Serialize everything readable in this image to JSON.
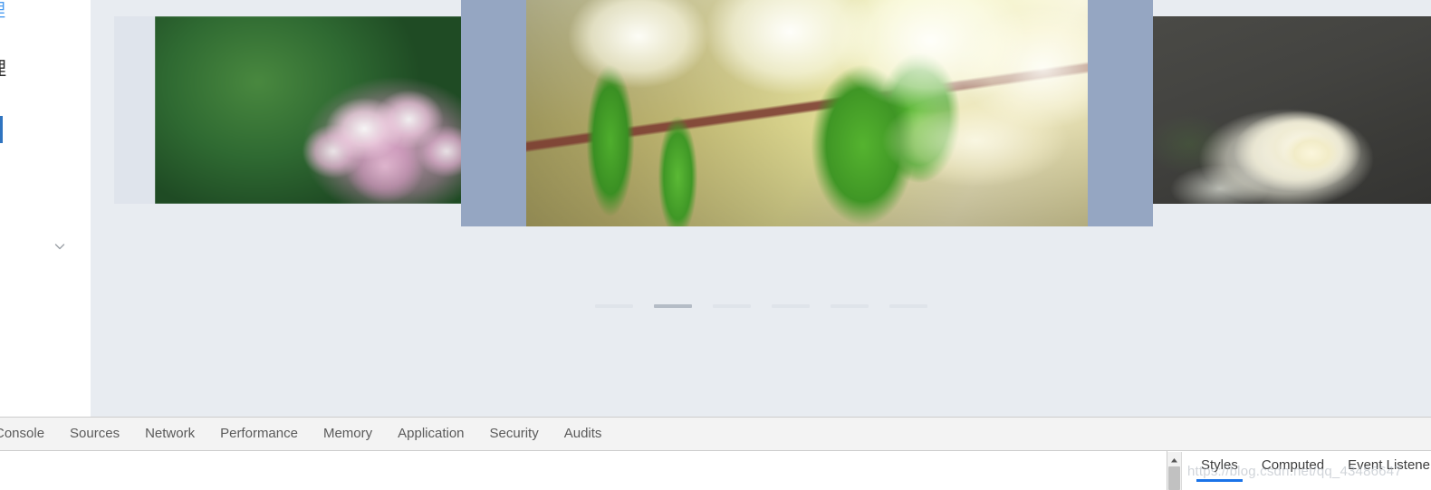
{
  "sidebar": {
    "top_link_label": "理",
    "section_label": "理",
    "active_item_label": "",
    "expand_icon": "chevron-down-icon"
  },
  "carousel": {
    "slides": [
      {
        "position": "previous",
        "alt": "Pink lilac blossoms against a blurred green background"
      },
      {
        "position": "active",
        "alt": "Backlit green leaves with bright white bokeh background"
      },
      {
        "position": "next",
        "alt": "White rose against a dark gray background"
      }
    ],
    "indicators": {
      "count": 6,
      "active_index": 1
    },
    "overlay_color": "#95a6c2",
    "background_color": "#e8ecf1"
  },
  "devtools": {
    "tabs": [
      {
        "label": "Console"
      },
      {
        "label": "Sources"
      },
      {
        "label": "Network"
      },
      {
        "label": "Performance"
      },
      {
        "label": "Memory"
      },
      {
        "label": "Application"
      },
      {
        "label": "Security"
      },
      {
        "label": "Audits"
      }
    ],
    "sidebar_pane_tabs": [
      {
        "label": "Styles",
        "active": true
      },
      {
        "label": "Computed",
        "active": false
      },
      {
        "label": "Event Listener",
        "active": false
      }
    ],
    "active_pane_accent": "#1a73e8",
    "scroll_up_icon": "scroll-up-arrow-icon"
  },
  "watermark": {
    "text": "https://blog.csdn.net/qq_43486647"
  }
}
